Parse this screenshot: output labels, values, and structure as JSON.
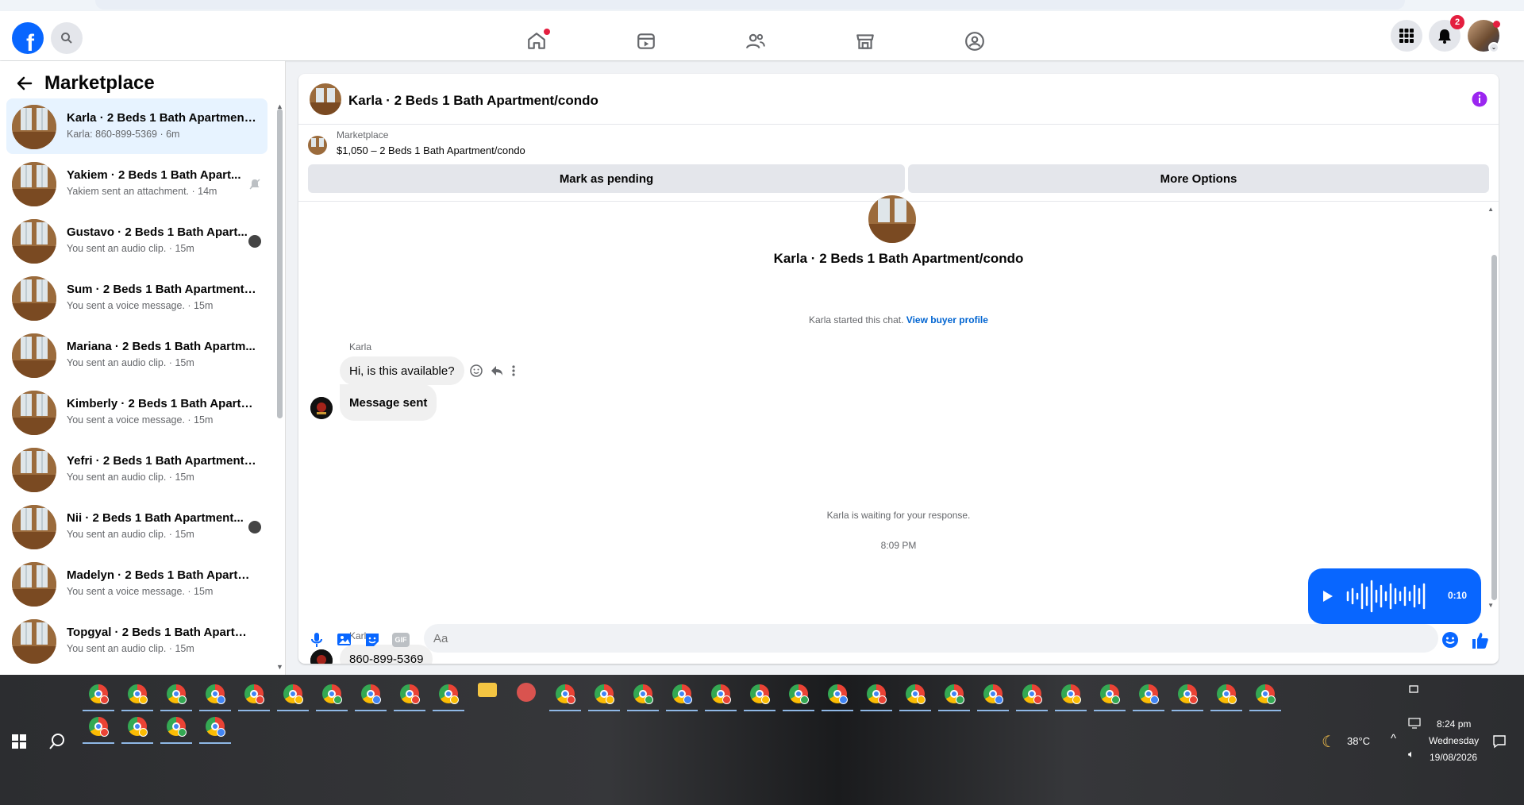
{
  "topnav": {
    "notifications_count": "2",
    "icons": [
      "home-icon",
      "video-icon",
      "friends-icon",
      "marketplace-icon",
      "groups-icon"
    ]
  },
  "sidebar": {
    "title": "Marketplace",
    "conversations": [
      {
        "title": "Karla · 2 Beds 1 Bath Apartment/...",
        "subtitle": "Karla: 860-899-5369 · 6m",
        "active": true
      },
      {
        "title": "Yakiem · 2 Beds 1 Bath Apart...",
        "subtitle": "Yakiem sent an attachment. · 14m"
      },
      {
        "title": "Gustavo · 2 Beds 1 Bath Apart...",
        "subtitle": "You sent an audio clip. · 15m"
      },
      {
        "title": "Sum · 2 Beds 1 Bath Apartment/...",
        "subtitle": "You sent a voice message. · 15m"
      },
      {
        "title": "Mariana · 2 Beds 1 Bath Apartm...",
        "subtitle": "You sent an audio clip. · 15m"
      },
      {
        "title": "Kimberly · 2 Beds 1 Bath Apartm...",
        "subtitle": "You sent a voice message. · 15m"
      },
      {
        "title": "Yefri · 2 Beds 1 Bath Apartment/...",
        "subtitle": "You sent an audio clip. · 15m"
      },
      {
        "title": "Nii · 2 Beds 1 Bath Apartment...",
        "subtitle": "You sent an audio clip. · 15m"
      },
      {
        "title": "Madelyn · 2 Beds 1 Bath Apartm...",
        "subtitle": "You sent a voice message. · 15m"
      },
      {
        "title": "Topgyal · 2 Beds 1 Bath Apartme...",
        "subtitle": "You sent an audio clip. · 15m"
      }
    ]
  },
  "chat": {
    "header_title": "Karla · 2 Beds 1 Bath Apartment/condo",
    "item_label": "Marketplace",
    "item_price": "$1,050 – 2 Beds 1 Bath Apartment/condo",
    "mark_pending": "Mark as pending",
    "more_options": "More Options",
    "profile_title": "Karla · 2 Beds 1 Bath Apartment/condo",
    "started_text": "Karla started this chat.",
    "view_profile": "View buyer profile",
    "messages": [
      {
        "sender": "Karla",
        "text": "Hi, is this available?"
      },
      {
        "text": "Message sent"
      },
      {
        "sender": "Karla",
        "text": "860-899-5369"
      }
    ],
    "waiting_text": "Karla is waiting for your response.",
    "timestamp": "8:09 PM",
    "voice_duration": "0:10",
    "composer_placeholder": "Aa"
  },
  "taskbar": {
    "weather": "38°C",
    "time": "8:24 pm",
    "day": "Wednesday",
    "date": "19/08/2026"
  },
  "colors": {
    "brand": "#0866ff",
    "active_bg": "#e7f3ff",
    "badge": "#e41e3f"
  }
}
